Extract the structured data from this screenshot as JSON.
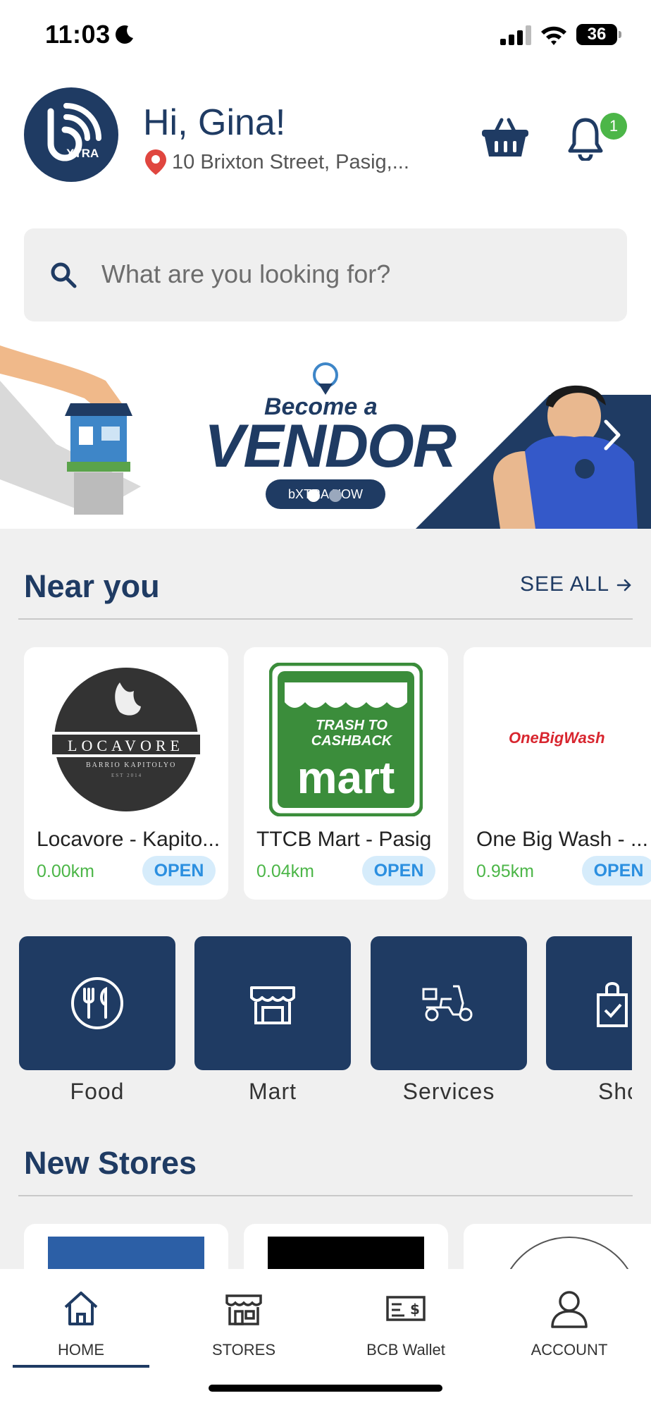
{
  "status_bar": {
    "time": "11:03",
    "battery": "36"
  },
  "header": {
    "greeting": "Hi, Gina!",
    "address": "10 Brixton Street, Pasig,...",
    "notification_count": "1",
    "logo_text": "XTRA"
  },
  "search": {
    "placeholder": "What are you looking for?"
  },
  "banner": {
    "line1": "Become a",
    "line2": "VENDOR",
    "cta": "bXTRA NOW",
    "slide_count": 2,
    "active_slide": 1
  },
  "near_you": {
    "title": "Near you",
    "see_all": "SEE ALL",
    "stores": [
      {
        "name": "Locavore - Kapito...",
        "distance": "0.00km",
        "status": "OPEN",
        "logo_text": "LOCAVORE",
        "logo_sub": "BARRIO KAPITOLYO",
        "logo_est": "EST 2014"
      },
      {
        "name": "TTCB Mart - Pasig",
        "distance": "0.04km",
        "status": "OPEN",
        "logo_text": "TRASH TO CASHBACK",
        "logo_sub": "mart"
      },
      {
        "name": "One Big Wash - ...",
        "distance": "0.95km",
        "status": "OPEN",
        "logo_text": "OneBigWash"
      }
    ]
  },
  "categories": [
    {
      "label": "Food",
      "icon": "food-icon"
    },
    {
      "label": "Mart",
      "icon": "store-icon"
    },
    {
      "label": "Services",
      "icon": "scooter-icon"
    },
    {
      "label": "Sho",
      "icon": "shopping-bag-icon"
    }
  ],
  "new_stores": {
    "title": "New Stores"
  },
  "bottom_nav": [
    {
      "label": "HOME",
      "icon": "home-icon",
      "active": true
    },
    {
      "label": "STORES",
      "icon": "store-icon",
      "active": false
    },
    {
      "label": "BCB Wallet",
      "icon": "wallet-icon",
      "active": false
    },
    {
      "label": "ACCOUNT",
      "icon": "account-icon",
      "active": false
    }
  ],
  "colors": {
    "brand": "#1f3b63",
    "green": "#4cb648",
    "open_bg": "#d6ecfb",
    "open_text": "#2b8fe0",
    "pin": "#e0463f"
  }
}
